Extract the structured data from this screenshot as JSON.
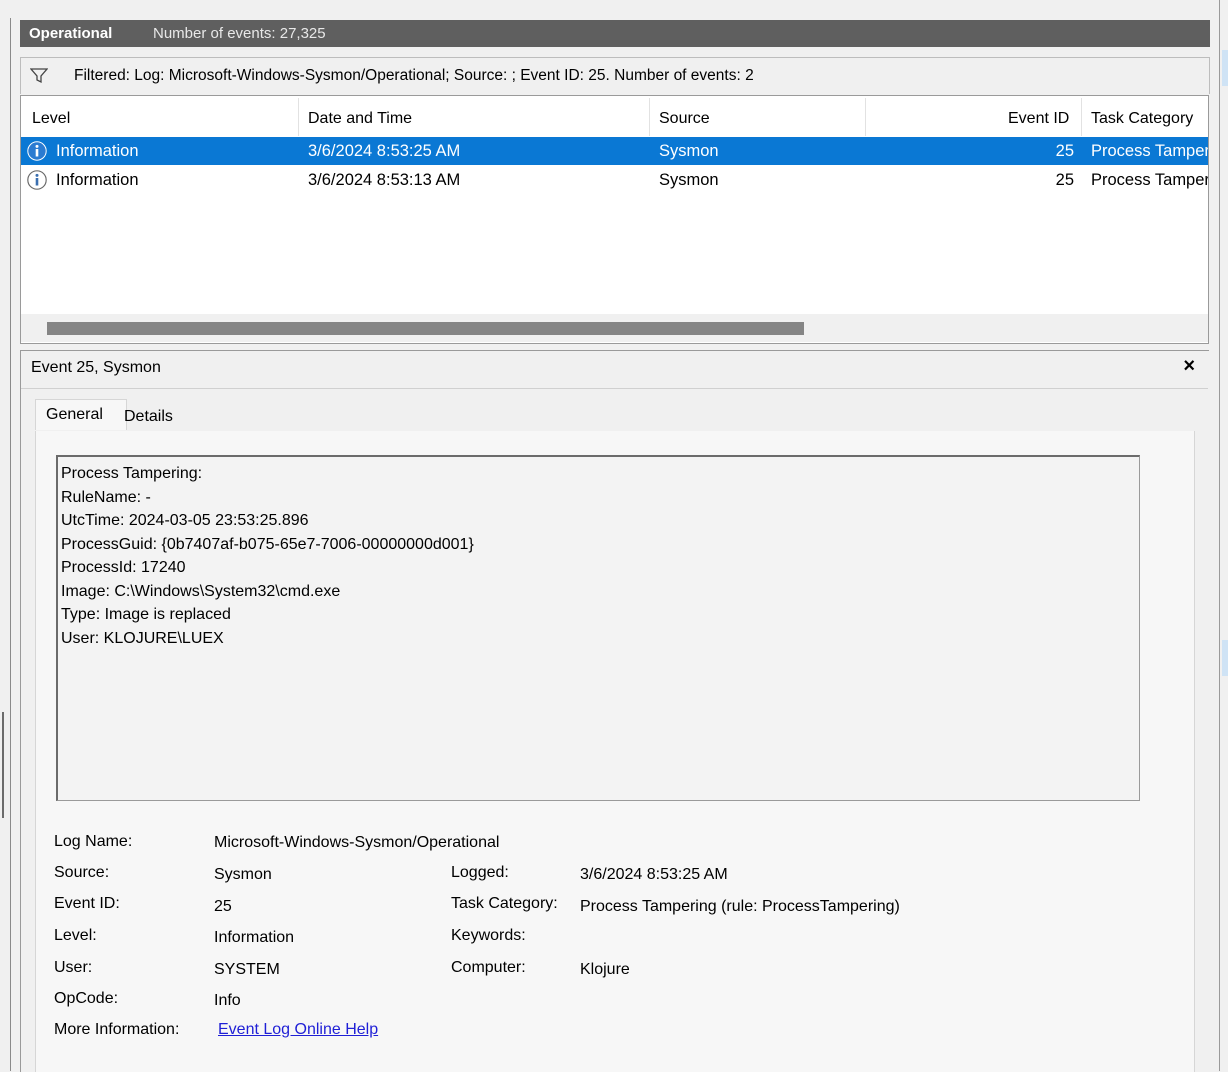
{
  "header": {
    "log_title": "Operational",
    "event_count": "Number of events: 27,325"
  },
  "filter": {
    "text": "Filtered: Log: Microsoft-Windows-Sysmon/Operational; Source: ; Event ID: 25. Number of events: 2"
  },
  "columns": {
    "level": "Level",
    "date_time": "Date and Time",
    "source": "Source",
    "event_id": "Event ID",
    "task_category": "Task Category"
  },
  "events": [
    {
      "level": "Information",
      "date_time": "3/6/2024 8:53:25 AM",
      "source": "Sysmon",
      "event_id": "25",
      "task_category": "Process Tampering (rule: ProcessTampering)",
      "selected": true
    },
    {
      "level": "Information",
      "date_time": "3/6/2024 8:53:13 AM",
      "source": "Sysmon",
      "event_id": "25",
      "task_category": "Process Tampering (rule: ProcessTampering)",
      "selected": false
    }
  ],
  "detail": {
    "title": "Event 25, Sysmon",
    "close_glyph": "×",
    "tabs": {
      "general": "General",
      "details": "Details"
    },
    "message_lines": [
      "Process Tampering:",
      "RuleName: -",
      "UtcTime: 2024-03-05 23:53:25.896",
      "ProcessGuid: {0b7407af-b075-65e7-7006-00000000d001}",
      "ProcessId: 17240",
      "Image: C:\\Windows\\System32\\cmd.exe",
      "Type: Image is replaced",
      "User: KLOJURE\\LUEX"
    ],
    "props": {
      "log_name_label": "Log Name:",
      "log_name": "Microsoft-Windows-Sysmon/Operational",
      "source_label": "Source:",
      "source": "Sysmon",
      "logged_label": "Logged:",
      "logged": "3/6/2024 8:53:25 AM",
      "event_id_label": "Event ID:",
      "event_id": "25",
      "task_category_label": "Task Category:",
      "task_category": "Process Tampering (rule: ProcessTampering)",
      "level_label": "Level:",
      "level": "Information",
      "keywords_label": "Keywords:",
      "keywords": "",
      "user_label": "User:",
      "user": "SYSTEM",
      "computer_label": "Computer:",
      "computer": "Klojure",
      "opcode_label": "OpCode:",
      "opcode": "Info",
      "more_info_label": "More Information:",
      "more_info_link": "Event Log Online Help"
    }
  },
  "colors": {
    "header_bg": "#5f5f5f",
    "selection": "#0a78d4",
    "info_icon": "#2b7bd1",
    "link": "#1f1fd6"
  }
}
